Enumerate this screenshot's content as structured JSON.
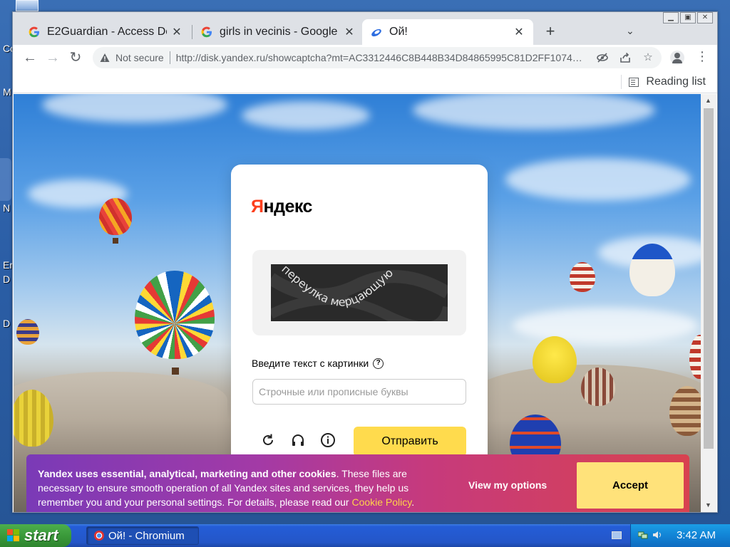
{
  "desktop": {
    "icon_labels": [
      "Co",
      "M",
      "N",
      "Er",
      "D",
      "D"
    ]
  },
  "browser": {
    "tabs": [
      {
        "title": "E2Guardian - Access De",
        "icon": "google-g-icon",
        "active": false
      },
      {
        "title": "girls in vecinis - Google S",
        "icon": "google-g-icon",
        "active": false
      },
      {
        "title": "Ой!",
        "icon": "yandex-disk-icon",
        "active": true
      }
    ],
    "new_tab_label": "+",
    "security_label": "Not secure",
    "url": "http://disk.yandex.ru/showcaptcha?mt=AC3312446C8B448B34D84865995C81D2FF107487...",
    "reading_list_label": "Reading list"
  },
  "page": {
    "logo_text": "Яндекс",
    "captcha_text": "переулка мерцающую",
    "instruction": "Введите текст с картинки",
    "input_placeholder": "Строчные или прописные буквы",
    "input_value": "",
    "submit_label": "Отправить"
  },
  "cookie_banner": {
    "bold_text": "Yandex uses essential, analytical, marketing and other cookies",
    "text": ". These files are necessary to ensure smooth operation of all Yandex sites and services, they help us remember you and your personal settings. For details, please read our ",
    "link_text": "Cookie Policy",
    "end_text": ".",
    "options_label": "View my options",
    "accept_label": "Accept",
    "colors": {
      "gradient_start": "#7a3ab7",
      "gradient_end": "#d8424f",
      "accept_bg": "#ffe27a",
      "link": "#ffd24a"
    }
  },
  "taskbar": {
    "start_label": "start",
    "task_label": "Ой! - Chromium",
    "clock": "3:42 AM"
  }
}
